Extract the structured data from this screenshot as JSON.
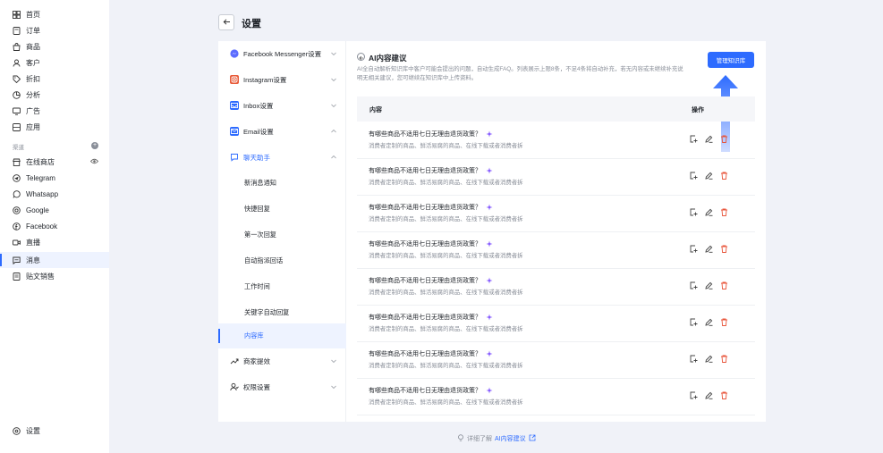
{
  "sidebar": {
    "items": [
      {
        "label": "首页",
        "icon": "dashboard-icon"
      },
      {
        "label": "订单",
        "icon": "order-icon"
      },
      {
        "label": "商品",
        "icon": "bag-icon"
      },
      {
        "label": "客户",
        "icon": "user-icon"
      },
      {
        "label": "折扣",
        "icon": "tag-icon"
      },
      {
        "label": "分析",
        "icon": "pie-icon"
      },
      {
        "label": "广告",
        "icon": "ad-icon"
      },
      {
        "label": "应用",
        "icon": "app-icon"
      }
    ],
    "section_label": "渠道",
    "channels": [
      {
        "label": "在线商店",
        "icon": "store-icon"
      },
      {
        "label": "Telegram",
        "icon": "telegram-icon"
      },
      {
        "label": "Whatsapp",
        "icon": "whatsapp-icon"
      },
      {
        "label": "Google",
        "icon": "google-icon"
      },
      {
        "label": "Facebook",
        "icon": "facebook-icon"
      },
      {
        "label": "直播",
        "icon": "live-icon"
      },
      {
        "label": "消息",
        "icon": "message-icon"
      },
      {
        "label": "贴文销售",
        "icon": "post-icon"
      }
    ],
    "settings_label": "设置"
  },
  "header": {
    "title": "设置"
  },
  "menu": {
    "items": [
      {
        "label": "Facebook Messenger设置",
        "icon": "messenger-icon"
      },
      {
        "label": "Instagram设置",
        "icon": "instagram-icon"
      },
      {
        "label": "Inbox设置",
        "icon": "inbox-icon"
      },
      {
        "label": "Email设置",
        "icon": "email-icon"
      },
      {
        "label": "聊天助手",
        "icon": "chat-assistant-icon"
      }
    ],
    "sub_items": [
      "新消息通知",
      "快捷回复",
      "第一次回复",
      "自动指派回话",
      "工作时间",
      "关键字自动回复",
      "内容库"
    ],
    "bottom_items": [
      {
        "label": "商家提效",
        "icon": "efficiency-icon"
      },
      {
        "label": "权限设置",
        "icon": "permission-icon"
      }
    ]
  },
  "content": {
    "title": "AI内容建议",
    "description": "AI全自动解析知识库中客户可能会提出的问题，自动生成FAQ。列表展示上限8条，不足4条将自动补充，若无内容或未继续补充说明无相关建议，您可继续在知识库中上传资料。",
    "manage_button": "管理知识库",
    "table": {
      "col_content": "内容",
      "col_action": "操作",
      "rows": [
        {
          "q": "有哪些商品不适用七日无理由退货政策？",
          "a": "消费者定制的商品、鲜活易腐的商品、在线下载或者消费者拆"
        },
        {
          "q": "有哪些商品不适用七日无理由退货政策？",
          "a": "消费者定制的商品、鲜活易腐的商品、在线下载或者消费者拆"
        },
        {
          "q": "有哪些商品不适用七日无理由退货政策？",
          "a": "消费者定制的商品、鲜活易腐的商品、在线下载或者消费者拆"
        },
        {
          "q": "有哪些商品不适用七日无理由退货政策？",
          "a": "消费者定制的商品、鲜活易腐的商品、在线下载或者消费者拆"
        },
        {
          "q": "有哪些商品不适用七日无理由退货政策？",
          "a": "消费者定制的商品、鲜活易腐的商品、在线下载或者消费者拆"
        },
        {
          "q": "有哪些商品不适用七日无理由退货政策？",
          "a": "消费者定制的商品、鲜活易腐的商品、在线下载或者消费者拆"
        },
        {
          "q": "有哪些商品不适用七日无理由退货政策？",
          "a": "消费者定制的商品、鲜活易腐的商品、在线下载或者消费者拆"
        },
        {
          "q": "有哪些商品不适用七日无理由退货政策？",
          "a": "消费者定制的商品、鲜活易腐的商品、在线下载或者消费者拆"
        }
      ]
    }
  },
  "footer": {
    "prefix": "详细了解",
    "link": "AI内容建议"
  },
  "colors": {
    "accent": "#2d6bff",
    "delete": "#e8553b",
    "sparkle": "#7b4dff"
  }
}
